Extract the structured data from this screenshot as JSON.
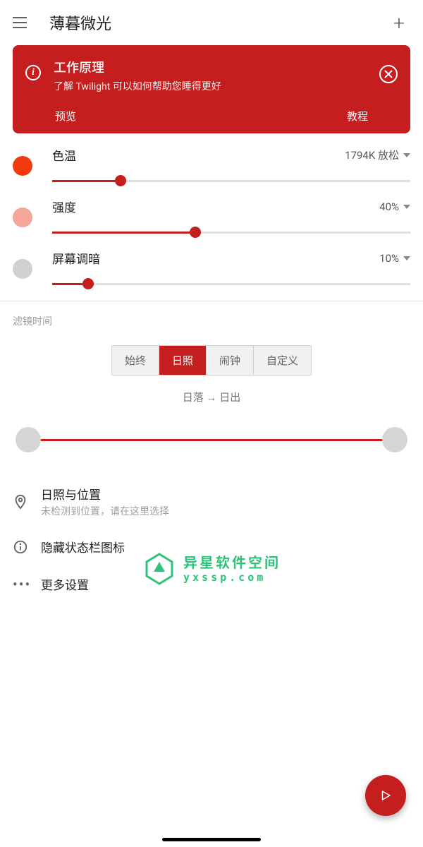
{
  "appbar": {
    "title": "薄暮微光"
  },
  "card": {
    "title": "工作原理",
    "subtitle": "了解 Twilight 可以如何帮助您睡得更好",
    "action_preview": "预览",
    "action_tutorial": "教程"
  },
  "sliders": {
    "color_temp": {
      "label": "色温",
      "value": "1794K 放松",
      "percent": 19
    },
    "intensity": {
      "label": "强度",
      "value": "40%",
      "percent": 40
    },
    "dim": {
      "label": "屏幕调暗",
      "value": "10%",
      "percent": 10
    }
  },
  "filter_section_label": "滤镜时间",
  "segments": {
    "always": "始终",
    "sun": "日照",
    "alarm": "闹钟",
    "custom": "自定义"
  },
  "timing_hint": "日落 → 日出",
  "list": {
    "location_title": "日照与位置",
    "location_sub": "未检测到位置，请在这里选择",
    "hide_icon": "隐藏状态栏图标",
    "more": "更多设置"
  },
  "watermark": {
    "line1": "异星软件空间",
    "line2": "yxssp.com"
  }
}
